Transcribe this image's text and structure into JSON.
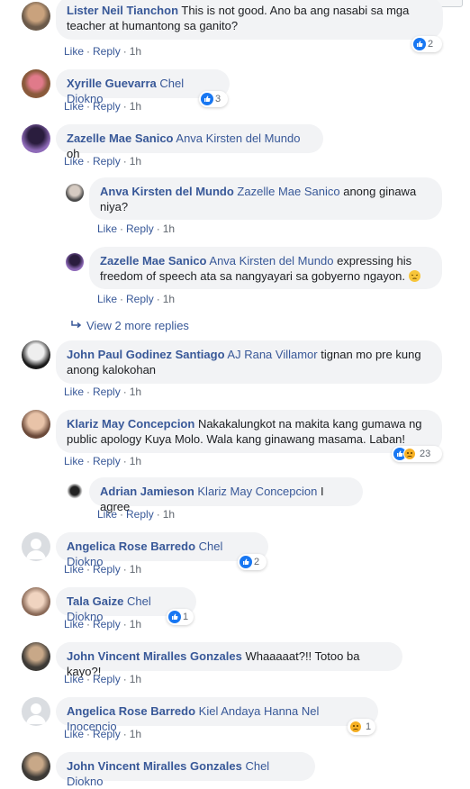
{
  "actions": {
    "like": "Like",
    "reply": "Reply",
    "sep": "·"
  },
  "comments": [
    {
      "name": "Lister Neil Tianchon",
      "text": "This is not good. Ano ba ang nasabi sa mga teacher at humantong sa ganito?",
      "time": "1h",
      "reactions": "2"
    },
    {
      "name": "Xyrille Guevarra",
      "mention": "Chel Diokno",
      "time": "1h",
      "reactions": "3"
    },
    {
      "name": "Zazelle Mae Sanico",
      "mention": "Anva Kirsten del Mundo",
      "text": "oh",
      "time": "1h"
    },
    {
      "name": "Anva Kirsten del Mundo",
      "mention": "Zazelle Mae Sanico",
      "text": "anong ginawa niya?",
      "time": "1h"
    },
    {
      "name": "Zazelle Mae Sanico",
      "mention": "Anva Kirsten del Mundo",
      "text": "expressing his freedom of speech ata sa nangyayari sa gobyerno ngayon.",
      "time": "1h"
    },
    {
      "name": "John Paul Godinez Santiago",
      "mention": "AJ Rana Villamor",
      "text": "tignan mo pre kung anong kalokohan",
      "time": "1h"
    },
    {
      "name": "Klariz May Concepcion",
      "text": "Nakakalungkot na makita kang gumawa ng public apology Kuya Molo. Wala kang ginawang masama. Laban!",
      "time": "1h",
      "reactions": "23"
    },
    {
      "name": "Adrian Jamieson",
      "mention": "Klariz May Concepcion",
      "text": "I agree",
      "time": "1h"
    },
    {
      "name": "Angelica Rose Barredo",
      "mention": "Chel Diokno",
      "time": "1h",
      "reactions": "2"
    },
    {
      "name": "Tala Gaize",
      "mention": "Chel Diokno",
      "time": "1h",
      "reactions": "1"
    },
    {
      "name": "John Vincent Miralles Gonzales",
      "text": "Whaaaaat?!! Totoo ba kayo?!",
      "time": "1h"
    },
    {
      "name": "Angelica Rose Barredo",
      "mention": "Kiel Andaya Hanna Nel Inocencio",
      "time": "1h",
      "reactions": "1"
    },
    {
      "name": "John Vincent Miralles Gonzales",
      "mention": "Chel Diokno"
    }
  ],
  "view_more": "View 2 more replies",
  "colors": {
    "link": "#385898",
    "bubble": "#f2f3f5",
    "like": "#1877f2",
    "sad": "#f7b125"
  }
}
